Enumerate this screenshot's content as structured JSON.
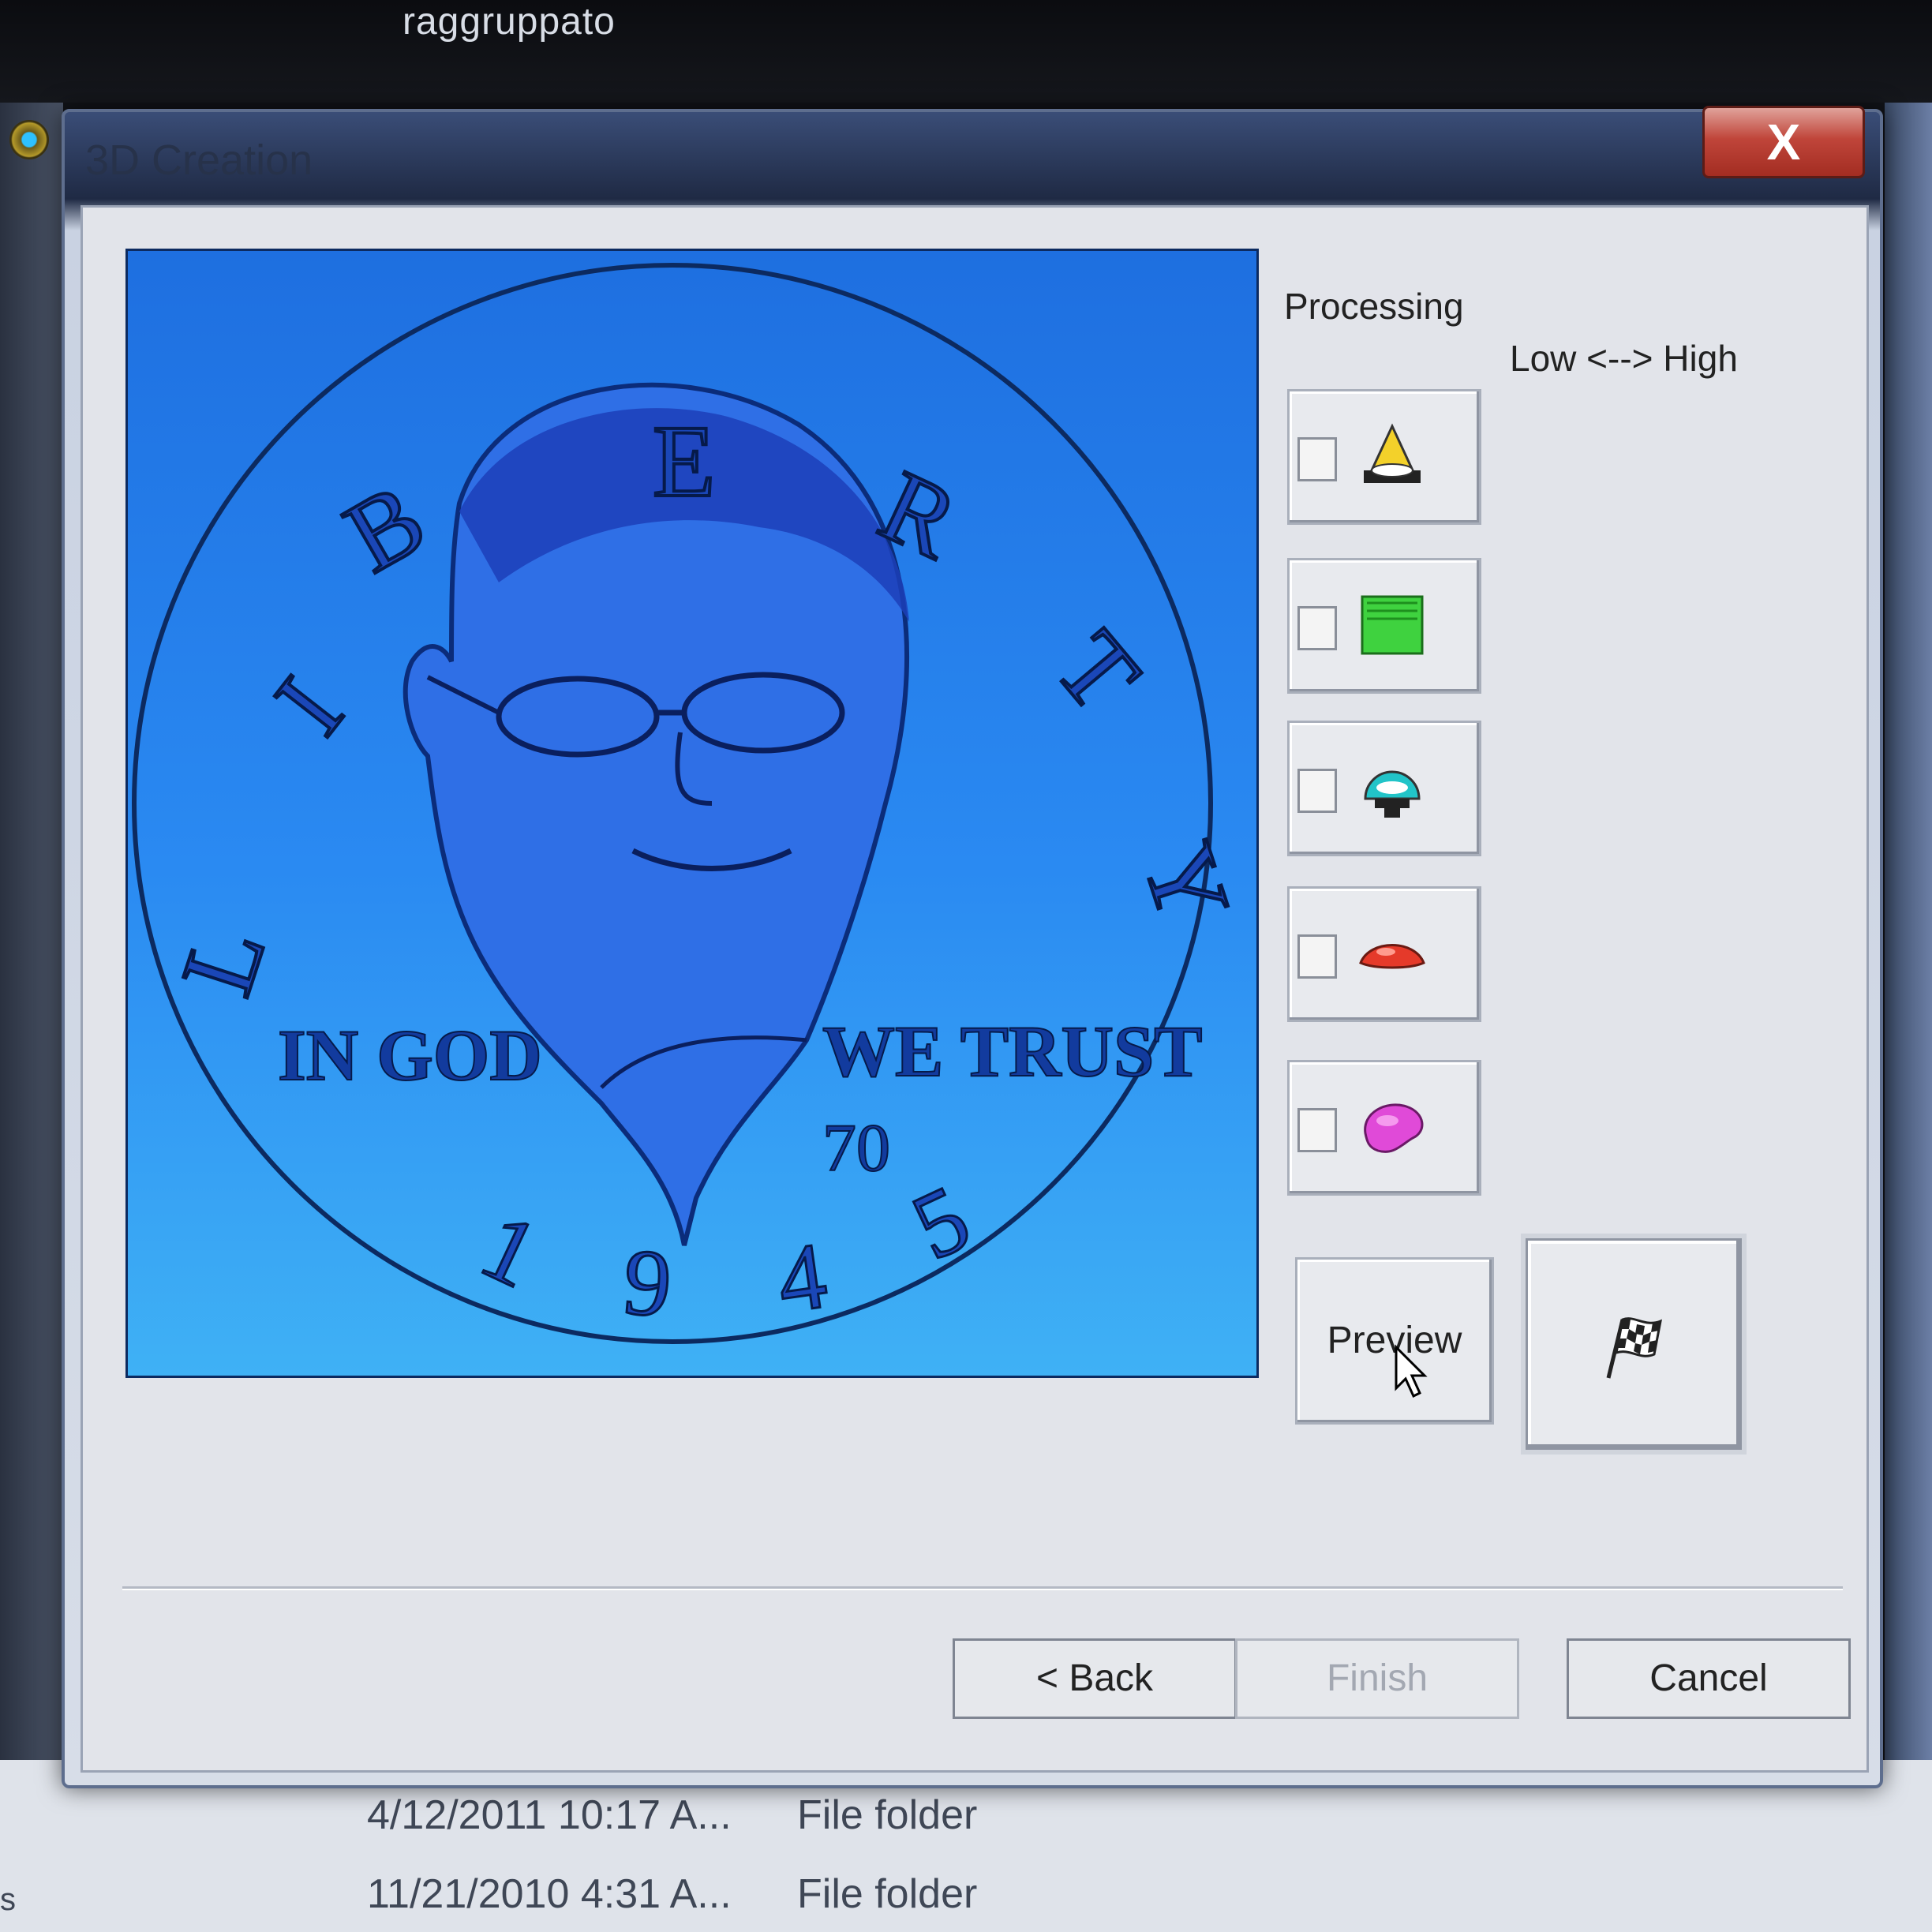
{
  "background_window": {
    "title_fragment": "raggruppato"
  },
  "explorer_rows": [
    {
      "date": "4/12/2011 10:17 A...",
      "type": "File folder"
    },
    {
      "date": "11/21/2010 4:31 A...",
      "type": "File folder"
    }
  ],
  "explorer_left_fragment": "s",
  "dialog": {
    "title": "3D Creation",
    "close_label": "X",
    "coin": {
      "letters_top": [
        "L",
        "I",
        "B",
        "E",
        "R",
        "T",
        "Y"
      ],
      "motto_left": "IN GOD",
      "motto_right": "WE TRUST",
      "age": "70",
      "year_digits": [
        "1",
        "9",
        "4",
        "5"
      ]
    },
    "processing_label": "Processing",
    "scale_label": "Low <--> High",
    "options": [
      {
        "icon": "yellow-cone-icon",
        "checked": false
      },
      {
        "icon": "green-texture-icon",
        "checked": false
      },
      {
        "icon": "cyan-dome-icon",
        "checked": false
      },
      {
        "icon": "red-lens-icon",
        "checked": false
      },
      {
        "icon": "pink-blob-icon",
        "checked": false
      }
    ],
    "preview_label": "Preview",
    "flag_icon": "checkered-flag-icon",
    "buttons": {
      "back": "< Back",
      "finish": "Finish",
      "cancel": "Cancel"
    },
    "finish_enabled": false
  },
  "colors": {
    "coin_bg_top": "#1e6fe0",
    "coin_bg_bottom": "#3fb1f5",
    "coin_ink": "#0c2a60",
    "close_red": "#c0453a"
  }
}
